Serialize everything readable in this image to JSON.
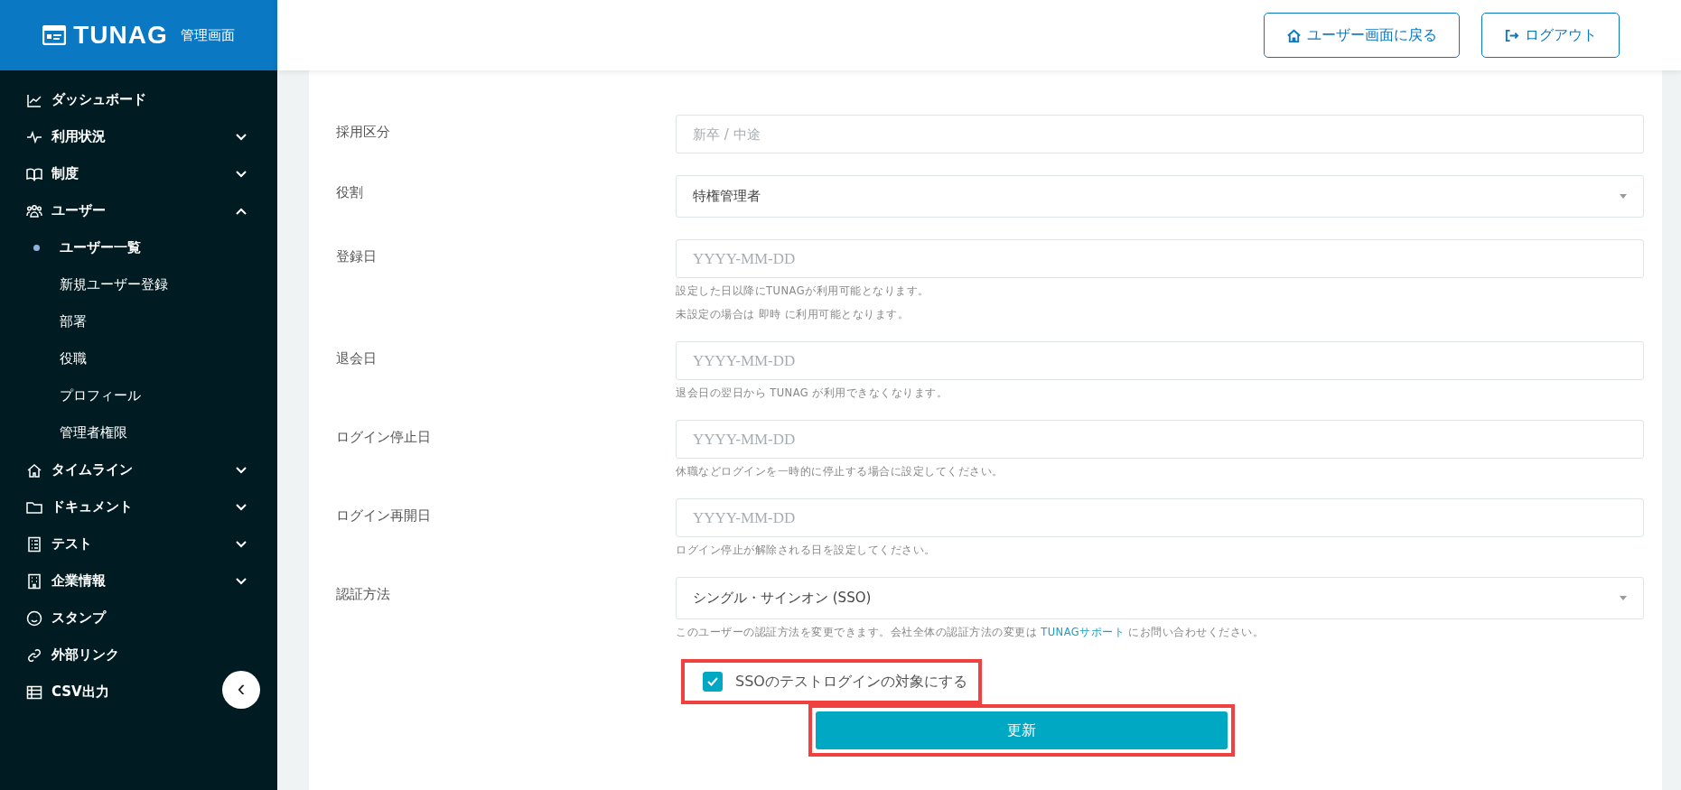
{
  "brand": {
    "name": "TUNAG",
    "subtitle": "管理画面"
  },
  "header": {
    "buttons": [
      {
        "label": "ユーザー画面に戻る"
      },
      {
        "label": "ログアウト"
      }
    ]
  },
  "sidebar": {
    "items": [
      {
        "label": "ダッシュボード",
        "kind": "link"
      },
      {
        "label": "利用状況",
        "kind": "group",
        "expanded": false
      },
      {
        "label": "制度",
        "kind": "group",
        "expanded": false
      },
      {
        "label": "ユーザー",
        "kind": "group",
        "expanded": true,
        "children": [
          {
            "label": "ユーザー一覧",
            "selected": true
          },
          {
            "label": "新規ユーザー登録",
            "selected": false
          },
          {
            "label": "部署",
            "selected": false
          },
          {
            "label": "役職",
            "selected": false
          },
          {
            "label": "プロフィール",
            "selected": false
          },
          {
            "label": "管理者権限",
            "selected": false
          }
        ]
      },
      {
        "label": "タイムライン",
        "kind": "group",
        "expanded": false
      },
      {
        "label": "ドキュメント",
        "kind": "group",
        "expanded": false
      },
      {
        "label": "テスト",
        "kind": "group",
        "expanded": false
      },
      {
        "label": "企業情報",
        "kind": "group",
        "expanded": false
      },
      {
        "label": "スタンプ",
        "kind": "link"
      },
      {
        "label": "外部リンク",
        "kind": "link"
      },
      {
        "label": "CSV出力",
        "kind": "link"
      }
    ],
    "collapse_button": "‹"
  },
  "form": {
    "rows": [
      {
        "label": "採用区分",
        "kind": "text",
        "placeholder": "新卒 / 中途"
      },
      {
        "label": "役割",
        "kind": "select",
        "value": "特権管理者"
      },
      {
        "label": "登録日",
        "kind": "date",
        "placeholder": "YYYY-MM-DD",
        "hints": [
          [
            {
              "kind": "plain",
              "text": "設定した日以降にTUNAGが利用可能となります。"
            }
          ],
          [
            {
              "kind": "plain",
              "text": "未設定の場合は 即時 に利用可能となります。"
            }
          ]
        ]
      },
      {
        "label": "退会日",
        "kind": "date",
        "placeholder": "YYYY-MM-DD",
        "hints": [
          [
            {
              "kind": "plain",
              "text": "退会日の翌日から TUNAG が利用できなくなります。"
            }
          ]
        ]
      },
      {
        "label": "ログイン停止日",
        "kind": "date",
        "placeholder": "YYYY-MM-DD",
        "hints": [
          [
            {
              "kind": "plain",
              "text": "休職などログインを一時的に停止する場合に設定してください。"
            }
          ]
        ]
      },
      {
        "label": "ログイン再開日",
        "kind": "date",
        "placeholder": "YYYY-MM-DD",
        "hints": [
          [
            {
              "kind": "plain",
              "text": "ログイン停止が解除される日を設定してください。"
            }
          ]
        ]
      },
      {
        "label": "認証方法",
        "kind": "select",
        "value": "シングル・サインオン (SSO)",
        "hints": [
          [
            {
              "kind": "plain",
              "text": "このユーザーの認証方法を変更できます。会社全体の認証方法の変更は "
            },
            {
              "kind": "link",
              "text": "TUNAGサポート"
            },
            {
              "kind": "plain",
              "text": " にお問い合わせください。"
            }
          ]
        ]
      }
    ],
    "checkbox": {
      "label": "SSOのテストログインの対象にする",
      "checked": true,
      "highlighted": true
    },
    "submit": {
      "label": "更新",
      "highlighted": true
    }
  }
}
